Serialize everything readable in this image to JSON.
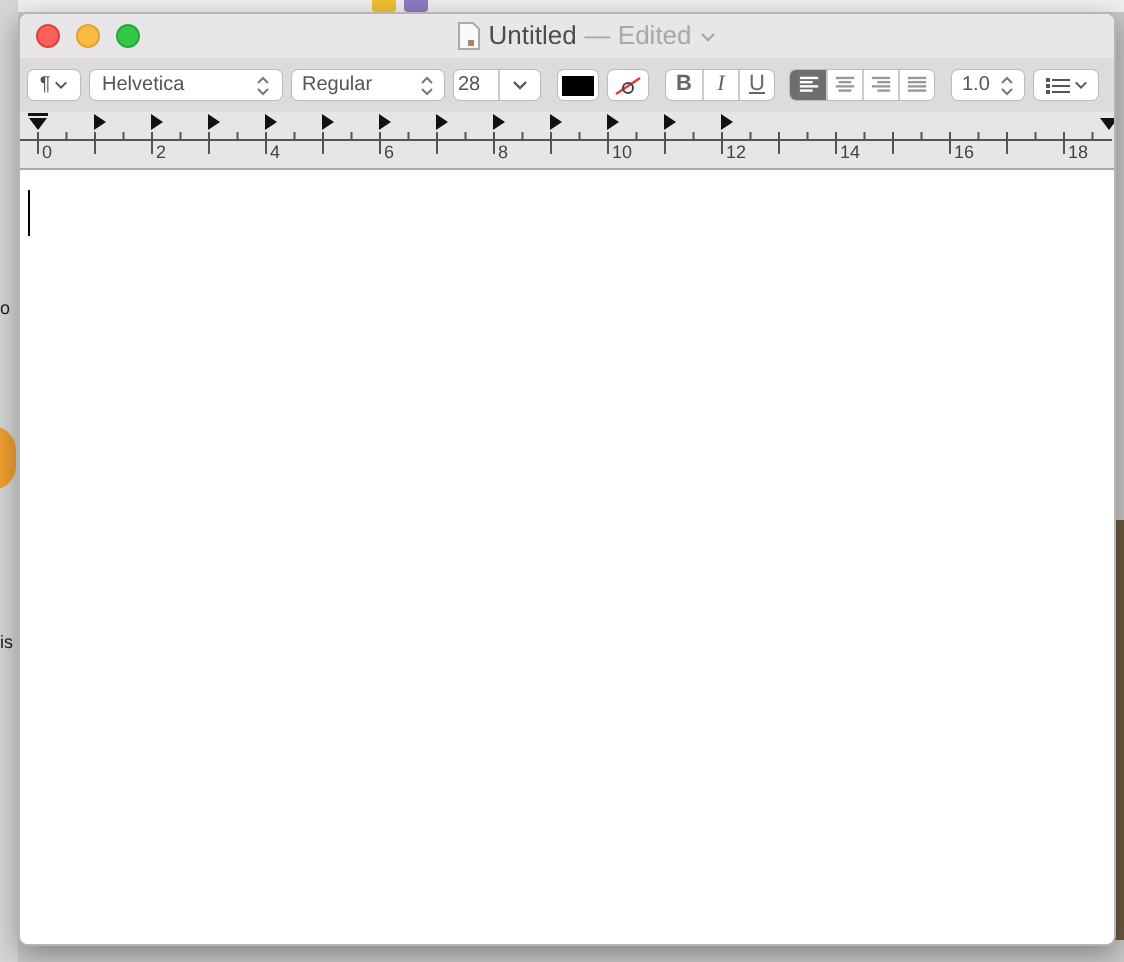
{
  "background": {
    "side_fragments": [
      "o",
      "is"
    ]
  },
  "window": {
    "title": "Untitled",
    "status": "— Edited"
  },
  "toolbar": {
    "paragraph_menu": "¶",
    "font_family": "Helvetica",
    "font_style": "Regular",
    "font_size": "28",
    "text_color": {
      "color": "#000000"
    },
    "styles": [
      {
        "label": "B",
        "on": false
      },
      {
        "label": "I",
        "on": false
      },
      {
        "label": "U",
        "on": false
      }
    ],
    "alignment": [
      {
        "kind": "left",
        "selected": true
      },
      {
        "kind": "center",
        "selected": false
      },
      {
        "kind": "right",
        "selected": false
      },
      {
        "kind": "justify",
        "selected": false
      }
    ],
    "line_spacing": "1.0"
  },
  "ruler": {
    "labels": [
      "0",
      "2",
      "4",
      "6",
      "8",
      "10",
      "12",
      "14",
      "16",
      "18"
    ]
  }
}
